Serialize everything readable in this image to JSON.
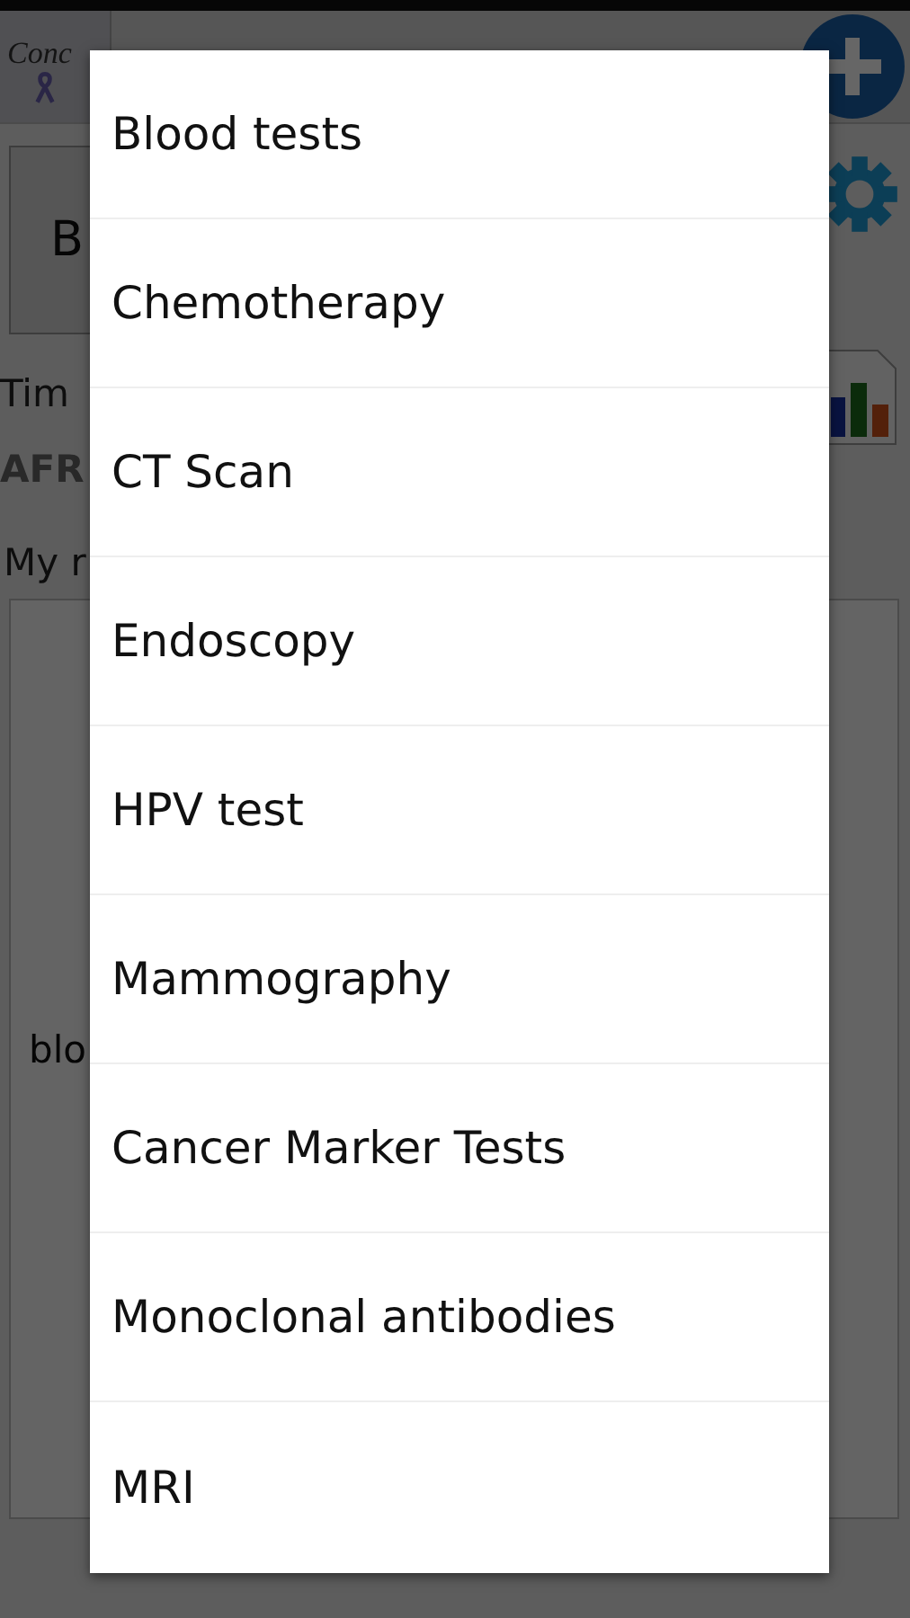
{
  "header": {
    "logo_text": "Conc"
  },
  "background": {
    "button_label": "B",
    "time_label": "Tim",
    "value_text": "AFR",
    "notes_label": "My r",
    "notes_text": "blo"
  },
  "dialog": {
    "items": [
      {
        "label": "Blood tests"
      },
      {
        "label": "Chemotherapy"
      },
      {
        "label": "CT Scan"
      },
      {
        "label": "Endoscopy"
      },
      {
        "label": "HPV test"
      },
      {
        "label": "Mammography"
      },
      {
        "label": "Cancer Marker Tests"
      },
      {
        "label": "Monoclonal antibodies"
      },
      {
        "label": "MRI"
      }
    ]
  }
}
